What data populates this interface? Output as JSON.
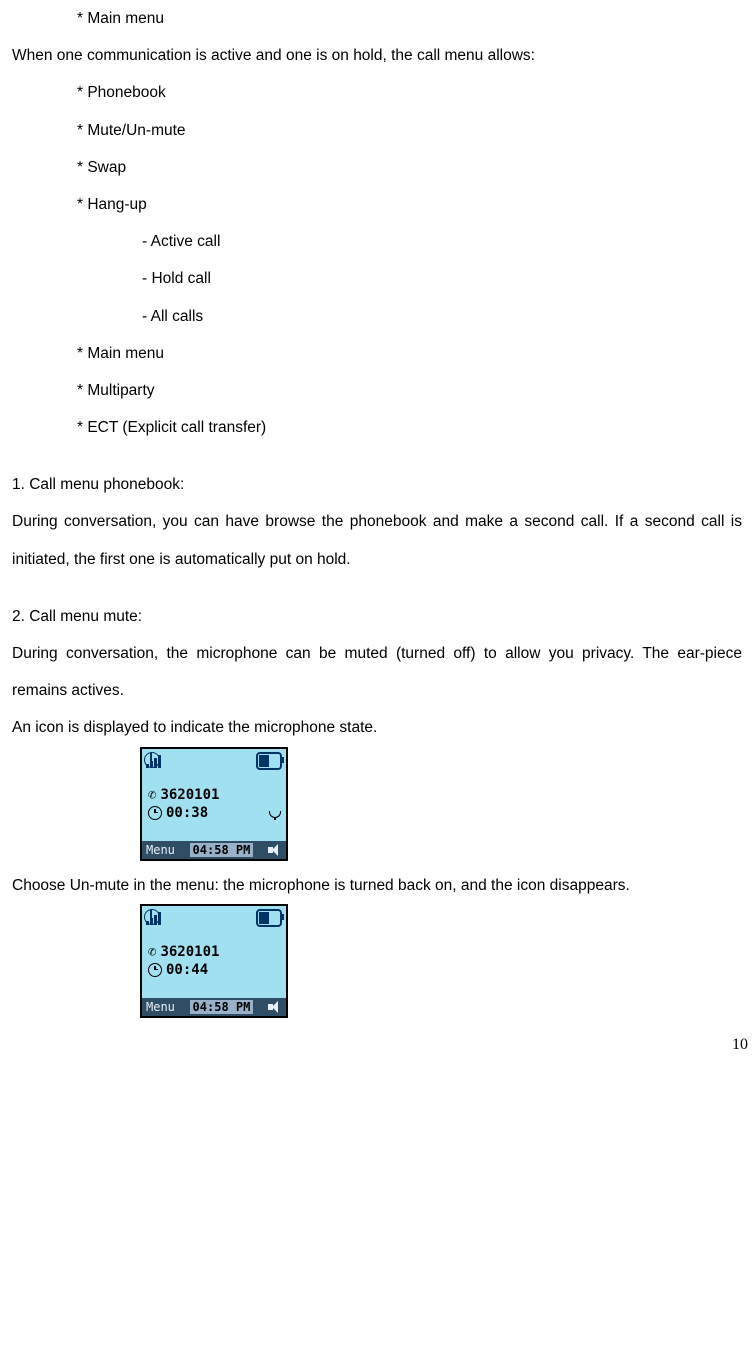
{
  "list_top": {
    "item0": "* Main menu"
  },
  "para_intro": "When one communication is active and one is on hold, the call menu allows:",
  "list_main": {
    "i1": "* Phonebook",
    "i2": "* Mute/Un-mute",
    "i3": "* Swap",
    "i4": "* Hang-up",
    "s1": "- Active call",
    "s2": "- Hold call",
    "s3": "- All calls",
    "i5": "* Main menu",
    "i6": "* Multiparty",
    "i7": "* ECT (Explicit call transfer)"
  },
  "sec1": {
    "heading": "1. Call menu phonebook:",
    "body": "During conversation, you can have browse the phonebook and make a second call. If a second call is initiated, the first one is automatically put on hold."
  },
  "sec2": {
    "heading": "2. Call menu mute:",
    "body1": "During conversation, the microphone can be muted (turned off) to allow you privacy. The ear-piece remains actives.",
    "body2": "An icon is displayed to indicate the microphone state."
  },
  "phone1": {
    "number": "3620101",
    "duration": "00:38",
    "menu_label": "Menu",
    "clock": "04:58 PM",
    "mic_muted": true
  },
  "para_mid": "Choose Un-mute in the menu: the microphone is turned back on, and the icon disappears.",
  "phone2": {
    "number": "3620101",
    "duration": "00:44",
    "menu_label": "Menu",
    "clock": "04:58 PM",
    "mic_muted": false
  },
  "page_number": "10"
}
